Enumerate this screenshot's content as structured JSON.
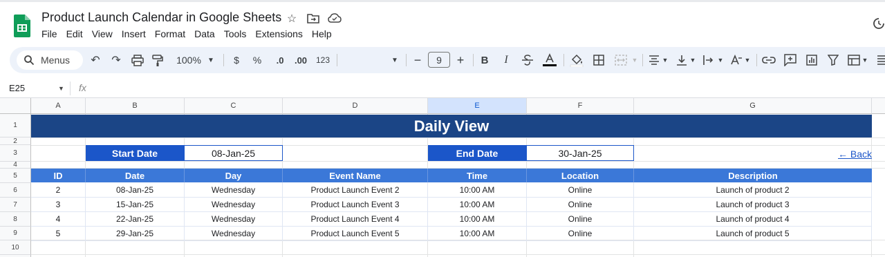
{
  "app": {
    "title": "Product Launch Calendar in Google Sheets",
    "menu": [
      "File",
      "Edit",
      "View",
      "Insert",
      "Format",
      "Data",
      "Tools",
      "Extensions",
      "Help"
    ]
  },
  "toolbar": {
    "menus_label": "Menus",
    "zoom": "100%",
    "currency": "$",
    "percent": "%",
    "decrease_decimal": ".0",
    "increase_decimal": ".00",
    "number_format": "123",
    "font_size": "9",
    "bold": "B",
    "italic": "I"
  },
  "formula_bar": {
    "cell_ref": "E25",
    "fx": "fx"
  },
  "columns": [
    "A",
    "B",
    "C",
    "D",
    "E",
    "F",
    "G"
  ],
  "selected_column": "E",
  "rows": [
    "1",
    "2",
    "3",
    "4",
    "5",
    "6",
    "7",
    "8",
    "9",
    "10"
  ],
  "sheet": {
    "banner": "Daily View",
    "start_label": "Start Date",
    "start_value": "08-Jan-25",
    "end_label": "End Date",
    "end_value": "30-Jan-25",
    "back_link": "← Back",
    "headers": [
      "ID",
      "Date",
      "Day",
      "Event Name",
      "Time",
      "Location",
      "Description"
    ],
    "data_rows": [
      [
        "2",
        "08-Jan-25",
        "Wednesday",
        "Product Launch Event 2",
        "10:00 AM",
        "Online",
        "Launch of product 2"
      ],
      [
        "3",
        "15-Jan-25",
        "Wednesday",
        "Product Launch Event 3",
        "10:00 AM",
        "Online",
        "Launch of product 3"
      ],
      [
        "4",
        "22-Jan-25",
        "Wednesday",
        "Product Launch Event 4",
        "10:00 AM",
        "Online",
        "Launch of product 4"
      ],
      [
        "5",
        "29-Jan-25",
        "Wednesday",
        "Product Launch Event 5",
        "10:00 AM",
        "Online",
        "Launch of product 5"
      ]
    ]
  },
  "colors": {
    "banner": "#1b4586",
    "date_label": "#1b56c9",
    "table_header": "#3b78d8",
    "selected_column_header": "#d3e3fd"
  }
}
